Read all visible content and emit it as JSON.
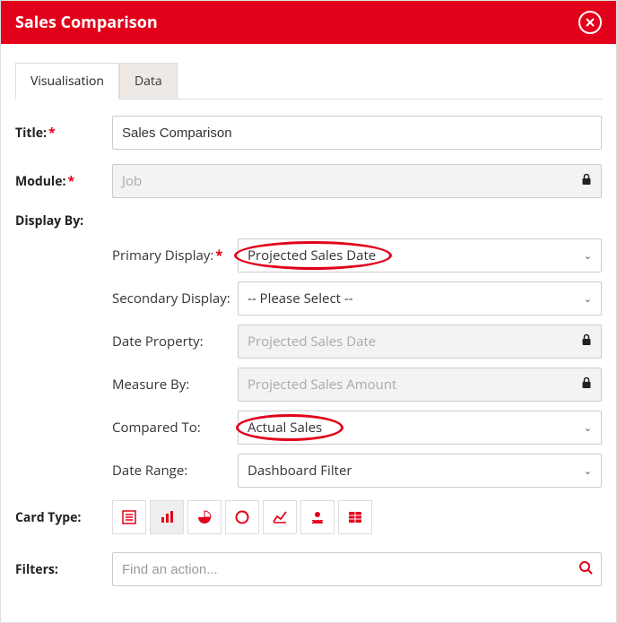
{
  "header": {
    "title": "Sales Comparison"
  },
  "tabs": {
    "visualisation": "Visualisation",
    "data": "Data"
  },
  "form": {
    "title_label": "Title:",
    "title_value": "Sales Comparison",
    "module_label": "Module:",
    "module_value": "Job",
    "display_by_label": "Display By:",
    "primary_display_label": "Primary Display:",
    "primary_display_value": "Projected Sales Date",
    "secondary_display_label": "Secondary Display:",
    "secondary_display_value": "-- Please Select --",
    "date_property_label": "Date Property:",
    "date_property_value": "Projected Sales Date",
    "measure_by_label": "Measure By:",
    "measure_by_value": "Projected Sales Amount",
    "compared_to_label": "Compared To:",
    "compared_to_value": "Actual Sales",
    "date_range_label": "Date Range:",
    "date_range_value": "Dashboard Filter",
    "card_type_label": "Card Type:",
    "filters_label": "Filters:",
    "filters_placeholder": "Find an action..."
  }
}
